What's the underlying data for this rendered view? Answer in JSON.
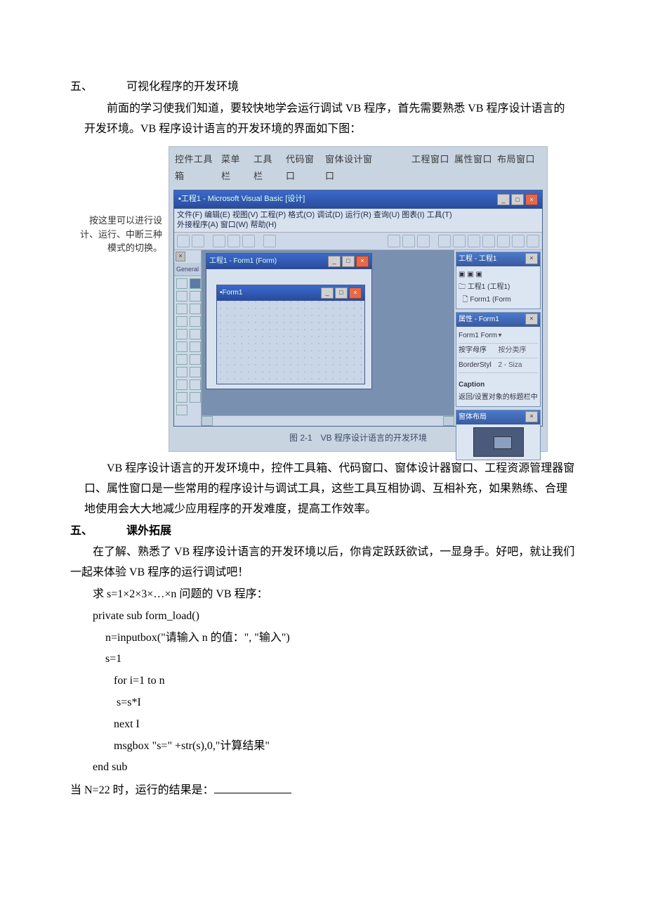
{
  "sec1": {
    "num": "五、",
    "title": "可视化程序的开发环境"
  },
  "p1": "前面的学习使我们知道，要较快地学会运行调试 VB 程序，首先需要熟悉 VB 程序设计语言的开发环境。VB 程序设计语言的开发环境的界面如下图：",
  "figure": {
    "top_labels": {
      "l1": "控件工具箱",
      "l2": "菜单栏",
      "l3": "工具栏",
      "l4": "代码窗口",
      "l5": "窗体设计窗口",
      "l6": "工程窗口",
      "l7": "属性窗口",
      "l8": "布局窗口"
    },
    "left_note": "按这里可以进行设计、运行、中断三种模式的切换。",
    "titlebar": "工程1 - Microsoft Visual Basic [设计]",
    "menubar_line1": "文件(F)  编辑(E)  视图(V)  工程(P)  格式(O)  调试(D)  运行(R)  查询(U)  图表(I)  工具(T)",
    "menubar_line2": "外接程序(A)  窗口(W)  帮助(H)",
    "toolbox_tab": "General",
    "form_outer_title": "工程1 - Form1 (Form)",
    "form_inner_title": "Form1",
    "proj_head": "工程 - 工程1",
    "proj_l1": "工程1 (工程1)",
    "proj_l2": "Form1 (Form",
    "prop_head": "属性 - Form1",
    "prop_name": "Form1 Form",
    "prop_tab1": "按字母序",
    "prop_tab2": "按分类序",
    "prop_row1k": "BorderStyl",
    "prop_row1v": "2 - Siza",
    "prop_cap_k": "Caption",
    "prop_cap_v": "返回/设置对象的标题栏中",
    "layout_head": "窗体布局",
    "caption": "图 2-1　VB 程序设计语言的开发环境"
  },
  "p2": "VB 程序设计语言的开发环境中，控件工具箱、代码窗口、窗体设计器窗口、工程资源管理器窗口、属性窗口是一些常用的程序设计与调试工具，这些工具互相协调、互相补充，如果熟练、合理地使用会大大地减少应用程序的开发难度，提高工作效率。",
  "sec2": {
    "num": "五、",
    "title": "课外拓展"
  },
  "p3": "在了解、熟悉了 VB 程序设计语言的开发环境以后，你肯定跃跃欲试，一显身手。好吧，就让我们一起来体验 VB 程序的运行调试吧！",
  "c1": "求 s=1×2×3×…×n 问题的 VB 程序：",
  "c2": "private sub form_load()",
  "c3": "n=inputbox(\"请输入 n 的值：\", \"输入\")",
  "c4": "s=1",
  "c5": "for i=1 to n",
  "c6": "s=s*I",
  "c7": "next I",
  "c8": "msgbox \"s=\" +str(s),0,\"计算结果\"",
  "c9": "end sub",
  "q": "当 N=22 时，运行的结果是："
}
